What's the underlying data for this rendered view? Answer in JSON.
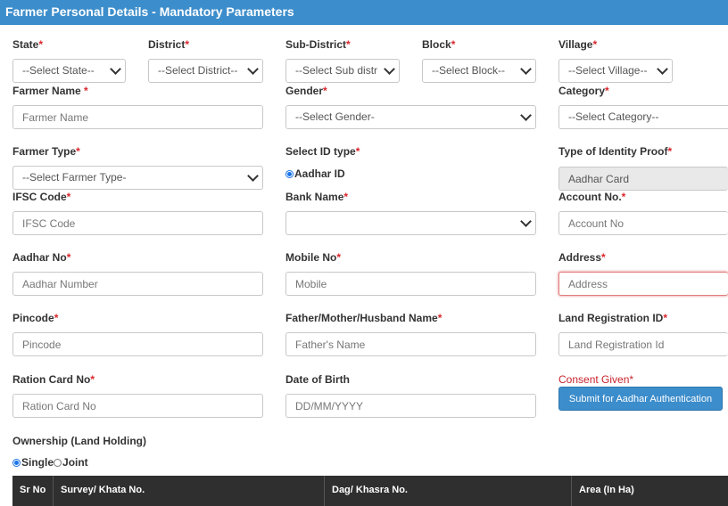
{
  "header": {
    "title": "Farmer Personal Details - Mandatory Parameters"
  },
  "fields": {
    "state": {
      "label": "State",
      "req": "*",
      "value": "--Select State--"
    },
    "district": {
      "label": "District",
      "req": "*",
      "value": "--Select District--"
    },
    "subdistrict": {
      "label": "Sub-District",
      "req": "*",
      "value": "--Select Sub distr"
    },
    "block": {
      "label": "Block",
      "req": "*",
      "value": "--Select Block--"
    },
    "village": {
      "label": "Village",
      "req": "*",
      "value": "--Select Village--"
    },
    "farmer_name": {
      "label": "Farmer Name ",
      "req": "*",
      "placeholder": "Farmer Name"
    },
    "gender": {
      "label": "Gender",
      "req": "*",
      "value": "--Select Gender-"
    },
    "category": {
      "label": "Category",
      "req": "*",
      "value": "--Select Category--"
    },
    "farmer_type": {
      "label": "Farmer Type",
      "req": "*",
      "value": "--Select Farmer Type-"
    },
    "id_type": {
      "label": "Select ID type",
      "req": "*",
      "option": "Aadhar ID"
    },
    "identity_proof": {
      "label": "Type of Identity Proof",
      "req": "*",
      "value": "Aadhar Card"
    },
    "ifsc": {
      "label": "IFSC Code",
      "req": "*",
      "placeholder": "IFSC Code"
    },
    "bank_name": {
      "label": "Bank Name",
      "req": "*",
      "value": ""
    },
    "account_no": {
      "label": "Account No.",
      "req": "*",
      "placeholder": "Account No"
    },
    "aadhar_no": {
      "label": "Aadhar No",
      "req": "*",
      "placeholder": "Aadhar Number"
    },
    "mobile_no": {
      "label": "Mobile No",
      "req": "*",
      "placeholder": "Mobile"
    },
    "address": {
      "label": "Address",
      "req": "*",
      "placeholder": "Address"
    },
    "pincode": {
      "label": "Pincode",
      "req": "*",
      "placeholder": "Pincode"
    },
    "guardian_name": {
      "label": "Father/Mother/Husband Name",
      "req": "*",
      "placeholder": "Father's Name"
    },
    "land_reg_id": {
      "label": "Land Registration ID",
      "req": "*",
      "placeholder": "Land Registration Id"
    },
    "ration_card": {
      "label": "Ration Card No",
      "req": "*",
      "placeholder": "Ration Card No"
    },
    "dob": {
      "label": "Date of Birth",
      "placeholder": "DD/MM/YYYY"
    }
  },
  "consent": {
    "label": "Consent Given",
    "req": "*",
    "button": "Submit for Aadhar Authentication"
  },
  "ownership": {
    "label": "Ownership (Land Holding)",
    "options": [
      "Single",
      "Joint"
    ],
    "selected": "Single"
  },
  "table": {
    "columns": [
      "Sr No",
      "Survey/ Khata No.",
      "Dag/ Khasra No.",
      "Area (In Ha)"
    ]
  }
}
